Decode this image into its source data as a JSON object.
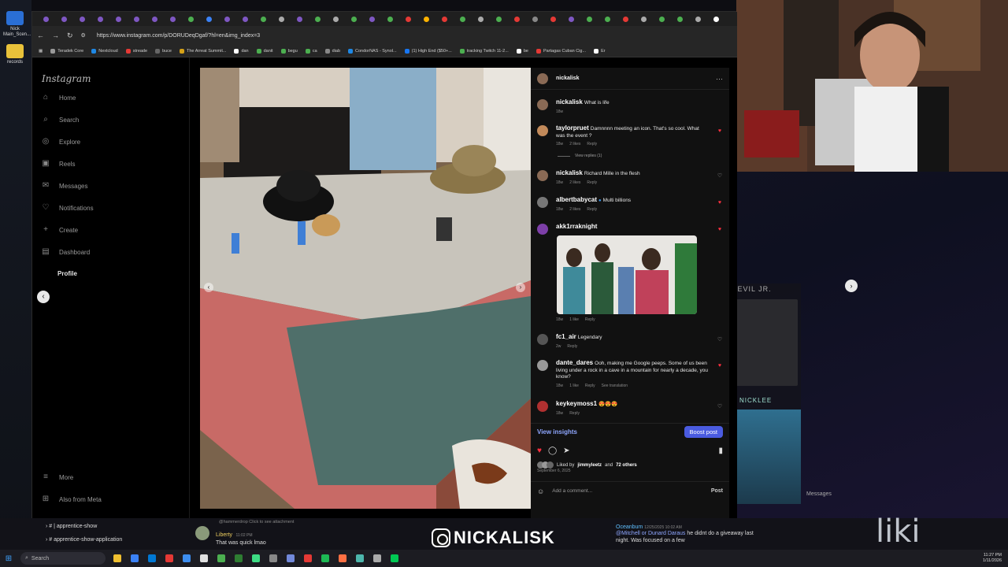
{
  "desktop": {
    "icons": [
      {
        "label": "Nick Main_Scen...",
        "color": "#2a6fd6"
      },
      {
        "label": "records",
        "color": "#e8c13a"
      }
    ]
  },
  "browser": {
    "url": "https://www.instagram.com/p/DORUDeqDgaf/?hl=en&img_index=3",
    "tab_colors": [
      "#7e57c2",
      "#7e57c2",
      "#7e57c2",
      "#7e57c2",
      "#7e57c2",
      "#7e57c2",
      "#7e57c2",
      "#7e57c2",
      "#4caf50",
      "#3b82f6",
      "#7e57c2",
      "#7e57c2",
      "#4caf50",
      "#aaaaaa",
      "#7e57c2",
      "#4caf50",
      "#aaaaaa",
      "#4caf50",
      "#7e57c2",
      "#4caf50",
      "#e53935",
      "#ffb300",
      "#e53935",
      "#4caf50",
      "#aaaaaa",
      "#4caf50",
      "#e53935",
      "#888888",
      "#e53935",
      "#7e57c2",
      "#4caf50",
      "#4caf50",
      "#e53935",
      "#aaaaaa",
      "#4caf50",
      "#4caf50",
      "#aaaaaa",
      "#ffffff"
    ],
    "bookmarks": [
      {
        "label": "Teradek Core",
        "color": "#999999"
      },
      {
        "label": "Nextcloud",
        "color": "#1e88e5"
      },
      {
        "label": "streade",
        "color": "#e53935"
      },
      {
        "label": "buce",
        "color": "#666666"
      },
      {
        "label": "The Arreat Summit...",
        "color": "#d4a017"
      },
      {
        "label": "dan",
        "color": "#ffffff"
      },
      {
        "label": "danit",
        "color": "#4caf50"
      },
      {
        "label": "begu",
        "color": "#4caf50"
      },
      {
        "label": "ca",
        "color": "#4caf50"
      },
      {
        "label": "diab",
        "color": "#888888"
      },
      {
        "label": "CondorNAS - Synol...",
        "color": "#1e88e5"
      },
      {
        "label": "(1) High End ($50+...",
        "color": "#1877f2"
      },
      {
        "label": "tracking Twitch 11-2...",
        "color": "#4caf50"
      },
      {
        "label": "be",
        "color": "#ffffff"
      },
      {
        "label": "Partagas Cuban Cig...",
        "color": "#e53935"
      },
      {
        "label": "Er",
        "color": "#ffffff"
      }
    ]
  },
  "instagram": {
    "logo": "Instagram",
    "nav": [
      {
        "label": "Home",
        "icon": "⌂",
        "top": 0
      },
      {
        "label": "Search",
        "icon": "⌕"
      },
      {
        "label": "Explore",
        "icon": "◎"
      },
      {
        "label": "Reels",
        "icon": "▣"
      },
      {
        "label": "Messages",
        "icon": "✉"
      },
      {
        "label": "Notifications",
        "icon": "♡"
      },
      {
        "label": "Create",
        "icon": "+"
      },
      {
        "label": "Dashboard",
        "icon": "▤"
      },
      {
        "label": "Profile",
        "icon": ""
      }
    ],
    "more": "More",
    "also_from_meta": "Also from Meta",
    "post_author": "nickalisk",
    "comments": [
      {
        "user": "nickalisk",
        "text": "What is life",
        "meta": [
          "18w"
        ],
        "heart": "none",
        "avatar": "#8a6a55"
      },
      {
        "user": "taylorpruet",
        "text": "Damnnnn meeting an icon. That's so cool. What was the event ?",
        "meta": [
          "18w",
          "2 likes",
          "Reply"
        ],
        "heart": "red",
        "avatar": "#c28a5a"
      },
      {
        "user": "nickalisk",
        "text": "Richard Mille in the flesh",
        "meta": [
          "18w",
          "2 likes",
          "Reply"
        ],
        "heart": "empty",
        "avatar": "#8a6a55"
      },
      {
        "user": "albertbabycat",
        "verified": "●",
        "text": "Multi billions",
        "meta": [
          "18w",
          "2 likes",
          "Reply"
        ],
        "heart": "red",
        "avatar": "#777777"
      },
      {
        "user": "akk1rraknight",
        "text": "",
        "meta": [
          "18w",
          "1 like",
          "Reply"
        ],
        "heart": "red",
        "avatar": "#7d3fa8"
      },
      {
        "user": "fc1_air",
        "text": "Legendary",
        "meta": [
          "2w",
          "Reply"
        ],
        "heart": "empty",
        "avatar": "#555555"
      },
      {
        "user": "dante_dares",
        "text": "Ooh, making me Google peeps. Some of us been living under a rock in a cave in a mountain for nearly a decade, you know?",
        "meta": [
          "18w",
          "1 like",
          "Reply",
          "See translation"
        ],
        "heart": "red",
        "avatar": "#999999"
      },
      {
        "user": "keykeymoss1",
        "text": "😍😍😍",
        "meta": [
          "18w",
          "Reply"
        ],
        "heart": "empty",
        "avatar": "#b03030"
      }
    ],
    "view_replies": "View replies (1)",
    "view_insights": "View insights",
    "boost": "Boost post",
    "liked_by_prefix": "Liked by",
    "liked_by_user": "jimmyleetz",
    "liked_by_suffix": "and",
    "liked_by_others": "72 others",
    "date": "September 6, 2025",
    "comment_placeholder": "Add a comment...",
    "post_button": "Post"
  },
  "stream": {
    "channel1": "apprentice-show",
    "channel2": "apprentice-show-application",
    "chat_mid_hint": "@hammerdrop  Click to see attachment",
    "chat_mid_user": "Liberty",
    "chat_mid_time": "11:02 PM",
    "chat_mid_text": "That was quick lmao",
    "chat_right_user": "Oceanbum",
    "chat_right_time": "12/25/2025 10:02 AM",
    "chat_right_mention": "@Mitchell or Dunard Daraus",
    "chat_right_text": "he didnt do a giveaway last night. Was focused on a few",
    "handle": "NICKALISK",
    "corner_logo": "liki",
    "overlay_labels": [
      "DEVIL JR.",
      "NICKLEE"
    ],
    "overlay_messages": "Messages"
  },
  "taskbar": {
    "search_placeholder": "Search",
    "time": "11:27 PM",
    "date": "1/11/2026",
    "apps": [
      "#f0c030",
      "#3b82f6",
      "#0078d4",
      "#e53935",
      "#3d8ef0",
      "#e0e0e0",
      "#4caf50",
      "#2e7d32",
      "#3ddc84",
      "#888888",
      "#7289da",
      "#e53935",
      "#1db954",
      "#ff7043",
      "#4db6ac",
      "#aaaaaa",
      "#00c853"
    ]
  }
}
